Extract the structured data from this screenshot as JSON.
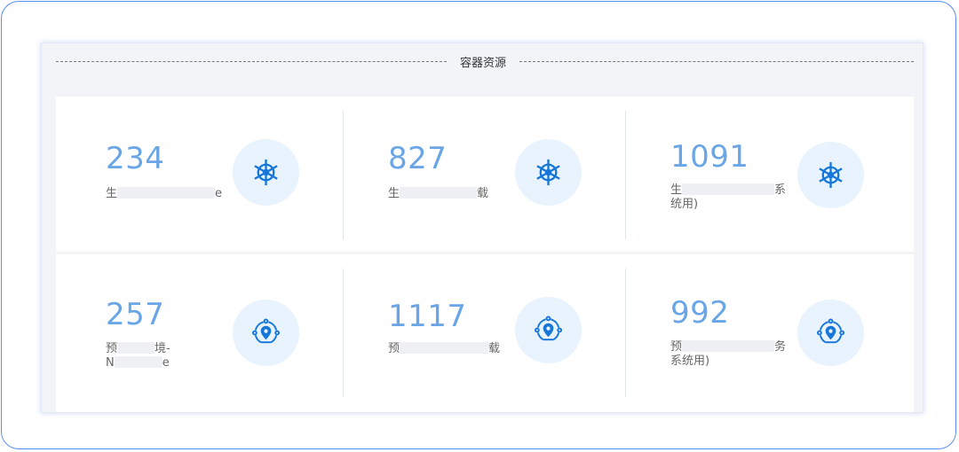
{
  "section": {
    "title": "容器资源"
  },
  "cards": [
    {
      "value": "234",
      "label_line1_start": "生",
      "label_line1_end": "e",
      "label_line2": "",
      "icon": "helm-wheel-icon"
    },
    {
      "value": "827",
      "label_line1_start": "生",
      "label_line1_end": "载",
      "label_line2": "",
      "icon": "helm-wheel-icon"
    },
    {
      "value": "1091",
      "label_line1_start": "生",
      "label_line1_end": "系",
      "label_line2": "统用)",
      "icon": "helm-wheel-icon"
    },
    {
      "value": "257",
      "label_line1_start": "预",
      "label_line1_end": "境-",
      "label_line2_start": "N",
      "label_line2_end": "e",
      "icon": "location-network-icon"
    },
    {
      "value": "1117",
      "label_line1_start": "预",
      "label_line1_end": "载",
      "label_line2": "",
      "icon": "location-network-icon"
    },
    {
      "value": "992",
      "label_line1_start": "预",
      "label_line1_end": "务",
      "label_line2": "系统用)",
      "icon": "location-network-icon"
    }
  ],
  "colors": {
    "accent": "#1677d9",
    "number": "#6aa6e6",
    "icon_bg": "#e8f3fe",
    "border": "#5b8def"
  }
}
